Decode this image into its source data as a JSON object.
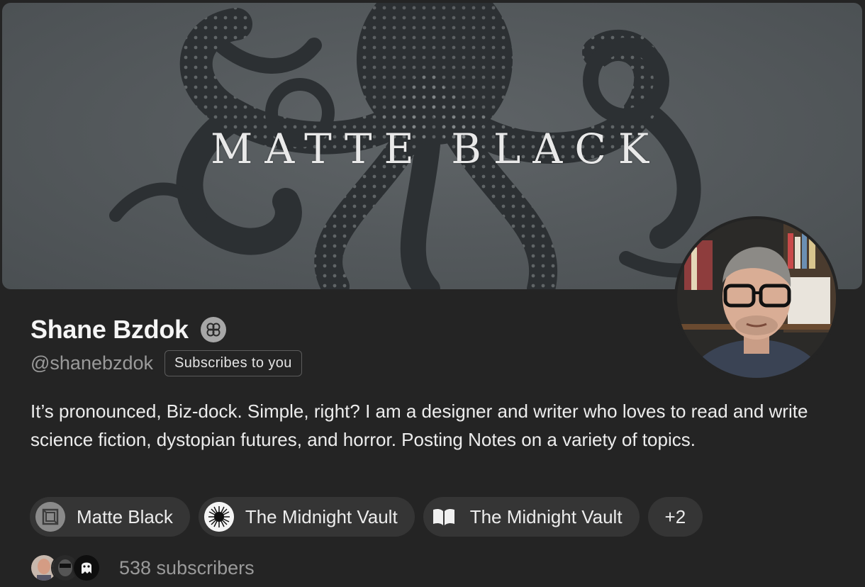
{
  "banner": {
    "title": "MATTE BLACK"
  },
  "profile": {
    "name": "Shane Bzdok",
    "handle": "@shanebzdok",
    "relation_badge": "Subscribes to you",
    "bio": "It’s pronounced, Biz-dock. Simple, right? I am a designer and writer who loves to read and write science fiction, dystopian futures, and horror. Posting Notes on a variety of topics."
  },
  "publications": [
    {
      "label": "Matte Black",
      "icon": "matte-black-logo"
    },
    {
      "label": "The Midnight Vault",
      "icon": "midnight-vault-burst-logo"
    },
    {
      "label": "The Midnight Vault",
      "icon": "open-book-icon"
    }
  ],
  "more_publications": "+2",
  "subscribers": {
    "label": "538 subscribers"
  },
  "colors": {
    "background": "#242424",
    "pill": "#353535",
    "muted_text": "#9a9a9a"
  }
}
